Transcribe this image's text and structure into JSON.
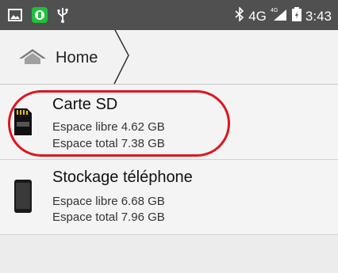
{
  "status_bar": {
    "time": "3:43",
    "network": "4G",
    "network_sup": "4G",
    "icons": [
      "screenshot-icon",
      "app-notification-icon",
      "usb-icon",
      "bluetooth-icon",
      "signal-icon",
      "battery-icon"
    ]
  },
  "breadcrumb": {
    "home_label": "Home",
    "home_icon": "home-icon"
  },
  "storage": {
    "items": [
      {
        "name": "Carte SD",
        "free": "Espace libre 4.62 GB",
        "total": "Espace total 7.38 GB",
        "icon": "sd-card-icon",
        "highlighted": true
      },
      {
        "name": "Stockage téléphone",
        "free": "Espace libre 6.68 GB",
        "total": "Espace total 7.96 GB",
        "icon": "phone-icon",
        "highlighted": false
      }
    ]
  },
  "colors": {
    "status_bar": "#505050",
    "highlight": "#e0141e",
    "app_notification": "#21c03a"
  }
}
